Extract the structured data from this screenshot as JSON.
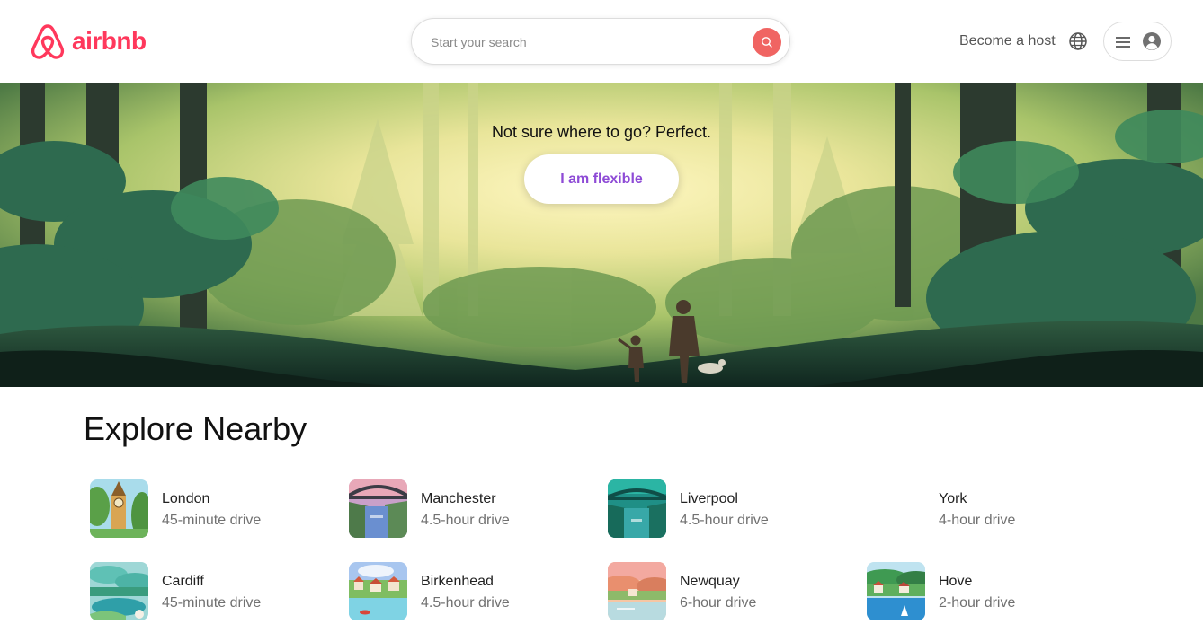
{
  "header": {
    "logo_text": "airbnb",
    "search_placeholder": "Start your search",
    "become_host": "Become a host",
    "brand_color": "#FF385C",
    "icons": [
      "airbnb-logo-icon",
      "search-icon",
      "globe-icon",
      "menu-icon",
      "user-avatar-icon"
    ]
  },
  "hero": {
    "tagline": "Not sure where to go? Perfect.",
    "button_label": "I am flexible",
    "button_color": "#8E4BD6"
  },
  "explore": {
    "title": "Explore Nearby",
    "items": [
      {
        "name": "London",
        "distance": "45-minute drive"
      },
      {
        "name": "Manchester",
        "distance": "4.5-hour drive"
      },
      {
        "name": "Liverpool",
        "distance": "4.5-hour drive"
      },
      {
        "name": "York",
        "distance": "4-hour drive"
      },
      {
        "name": "Cardiff",
        "distance": "45-minute drive"
      },
      {
        "name": "Birkenhead",
        "distance": "4.5-hour drive"
      },
      {
        "name": "Newquay",
        "distance": "6-hour drive"
      },
      {
        "name": "Hove",
        "distance": "2-hour drive"
      }
    ]
  }
}
